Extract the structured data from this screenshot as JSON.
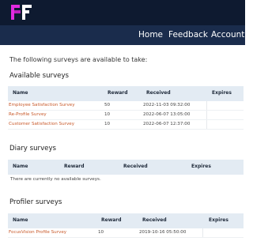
{
  "nav": {
    "home": "Home",
    "feedback": "Feedback",
    "account": "Account"
  },
  "intro": "The following surveys are available to take:",
  "available": {
    "title": "Available surveys",
    "columns": {
      "name": "Name",
      "reward": "Reward",
      "received": "Received",
      "expires": "Expires"
    },
    "rows": [
      {
        "name": "Employee Satisfaction Survey",
        "reward": "50",
        "received": "2022-11-03 09:32:00",
        "expires": ""
      },
      {
        "name": "Re-Profile Survey",
        "reward": "10",
        "received": "2022-06-07 13:05:00",
        "expires": ""
      },
      {
        "name": "Customer Satisfaction Survey",
        "reward": "10",
        "received": "2022-06-07 12:37:00",
        "expires": ""
      }
    ]
  },
  "diary": {
    "title": "Diary surveys",
    "columns": {
      "name": "Name",
      "reward": "Reward",
      "received": "Received",
      "expires": "Expires"
    },
    "empty_text": "There are currently no available surveys."
  },
  "profiler": {
    "title": "Profiler surveys",
    "columns": {
      "name": "Name",
      "reward": "Reward",
      "received": "Received",
      "expires": "Expires"
    },
    "rows": [
      {
        "name": "FocusVision Profile Survey",
        "reward": "10",
        "received": "2019-10-16 05:50:00",
        "expires": ""
      }
    ]
  },
  "colors": {
    "topbar": "#0e1a30",
    "navbar": "#1a2c4c",
    "logo_magenta": "#e22be0",
    "link": "#c8592a",
    "table_header": "#e3ebf3"
  },
  "icons": {
    "logo": "brand-logo-icon"
  }
}
